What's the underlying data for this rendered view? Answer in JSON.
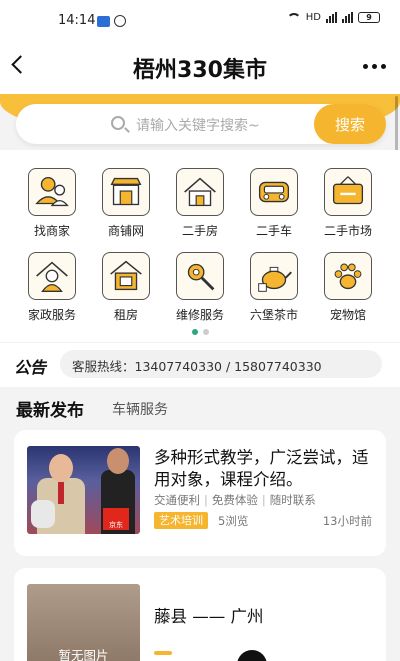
{
  "status_bar": {
    "time": "14:14",
    "network": "HD",
    "battery": "9"
  },
  "header": {
    "title": "梧州330集市"
  },
  "search": {
    "placeholder": "请输入关键字搜索~",
    "button_label": "搜索"
  },
  "categories": [
    {
      "label": "找商家",
      "icon": "merchant-people-icon"
    },
    {
      "label": "商铺网",
      "icon": "shopfront-icon"
    },
    {
      "label": "二手房",
      "icon": "house-icon"
    },
    {
      "label": "二手车",
      "icon": "car-icon"
    },
    {
      "label": "二手市场",
      "icon": "second-hand-sign-icon"
    },
    {
      "label": "家政服务",
      "icon": "housekeeper-icon"
    },
    {
      "label": "租房",
      "icon": "rent-house-icon"
    },
    {
      "label": "维修服务",
      "icon": "repair-tools-icon"
    },
    {
      "label": "六堡茶市",
      "icon": "teapot-icon"
    },
    {
      "label": "宠物馆",
      "icon": "paw-icon"
    }
  ],
  "carousel": {
    "page_count": 2,
    "active_index": 0
  },
  "notice": {
    "label": "公告",
    "text": "客服热线：13407740330 / 15807740330"
  },
  "tabs": [
    {
      "label": "最新发布",
      "active": true
    },
    {
      "label": "车辆服务",
      "active": false
    }
  ],
  "listings": [
    {
      "title": "多种形式教学，广泛尝试，适用对象，课程介绍。",
      "tags": [
        "交通便利",
        "免费体验",
        "随时联系"
      ],
      "category": "艺术培训",
      "views": "5浏览",
      "time": "13小时前",
      "thumb_logo": "京东"
    },
    {
      "title": "藤县 —— 广州",
      "thumb_text": "暂无图片"
    }
  ],
  "colors": {
    "accent": "#f5b52f",
    "band": "#f7bf3a",
    "dot_active": "#2ba87a"
  }
}
